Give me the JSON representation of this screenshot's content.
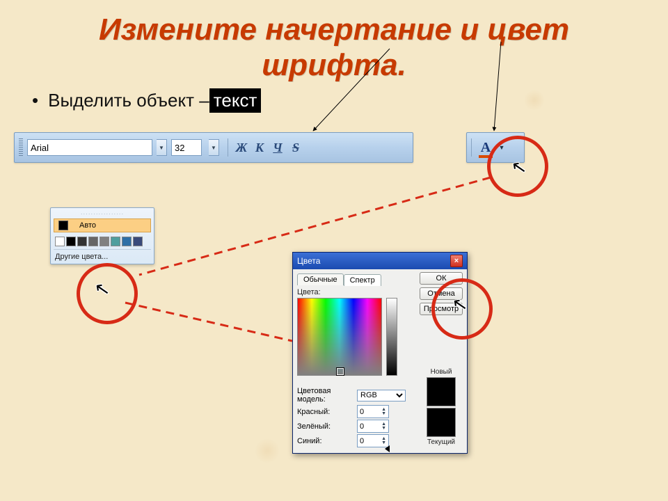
{
  "title_line1": "Измените начертание и цвет",
  "title_line2": "шрифта.",
  "bullet_prefix": "Выделить объект – ",
  "bullet_highlight": "текст",
  "toolbar": {
    "font_name": "Arial",
    "font_size": "32",
    "bold": "Ж",
    "italic": "К",
    "underline": "Ч",
    "strike": "S",
    "fontcolor_glyph": "A"
  },
  "popup": {
    "auto_label": "Авто",
    "more_label": "Другие цвета...",
    "swatches": [
      "#ffffff",
      "#000000",
      "#333333",
      "#666666",
      "#808080",
      "#4f9e9e",
      "#2e6fa6",
      "#3a4a7a"
    ]
  },
  "dialog": {
    "title": "Цвета",
    "tab_standard": "Обычные",
    "tab_spectrum": "Спектр",
    "btn_ok": "ОК",
    "btn_cancel": "Отмена",
    "btn_view": "Просмотр",
    "label_colors": "Цвета:",
    "label_model": "Цветовая модель:",
    "model_value": "RGB",
    "label_red": "Красный:",
    "label_green": "Зелёный:",
    "label_blue": "Синий:",
    "val_red": "0",
    "val_green": "0",
    "val_blue": "0",
    "label_new": "Новый",
    "label_current": "Текущий"
  }
}
